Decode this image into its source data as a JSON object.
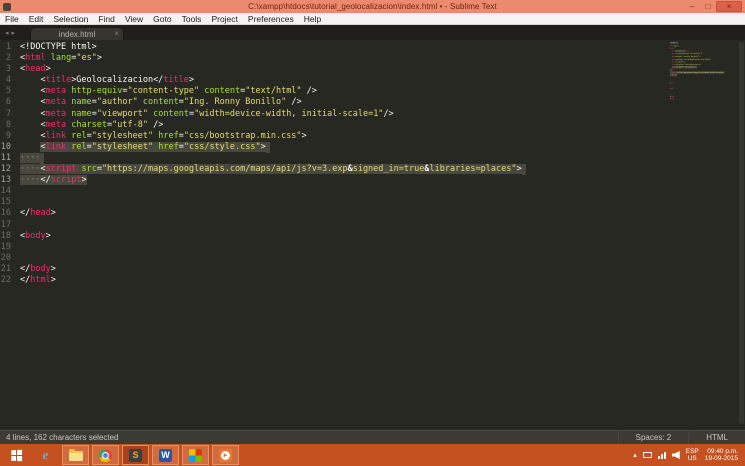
{
  "window": {
    "title": "C:\\xampp\\htdocs\\tutorial_geolocalizacion\\index.html • - Sublime Text",
    "controls": {
      "minimize": "–",
      "maximize": "□",
      "close": "×"
    }
  },
  "menu": {
    "items": [
      "File",
      "Edit",
      "Selection",
      "Find",
      "View",
      "Goto",
      "Tools",
      "Project",
      "Preferences",
      "Help"
    ]
  },
  "tabs": {
    "scroll_left_icon": "◂",
    "scroll_right_icon": "▸",
    "active": {
      "label": "index.html",
      "close_icon": "×"
    }
  },
  "editor": {
    "syntax_colors": {
      "w": "#F8F8F2",
      "tag": "#F92672",
      "attr": "#A6E22E",
      "str": "#E6DB74",
      "ws": "#8a8a7f",
      "b": "#F8F8F2"
    },
    "selection_bg": "#49483E",
    "background": "#272822",
    "lines": [
      {
        "n": 1,
        "segs": [
          [
            "w",
            "<!DOCTYPE html>"
          ]
        ]
      },
      {
        "n": 2,
        "segs": [
          [
            "w",
            "<"
          ],
          [
            "tag",
            "html"
          ],
          [
            "w",
            " "
          ],
          [
            "attr",
            "lang"
          ],
          [
            "w",
            "="
          ],
          [
            "str",
            "\"es\""
          ],
          [
            "w",
            ">"
          ]
        ]
      },
      {
        "n": 3,
        "segs": [
          [
            "w",
            "<"
          ],
          [
            "tag",
            "head"
          ],
          [
            "w",
            ">"
          ]
        ]
      },
      {
        "n": 4,
        "segs": [
          [
            "w",
            "    <"
          ],
          [
            "tag",
            "title"
          ],
          [
            "w",
            ">Geolocalizacion</"
          ],
          [
            "tag",
            "title"
          ],
          [
            "w",
            ">"
          ]
        ]
      },
      {
        "n": 5,
        "segs": [
          [
            "w",
            "    <"
          ],
          [
            "tag",
            "meta"
          ],
          [
            "w",
            " "
          ],
          [
            "attr",
            "http-equiv"
          ],
          [
            "w",
            "="
          ],
          [
            "str",
            "\"content-type\""
          ],
          [
            "w",
            " "
          ],
          [
            "attr",
            "content"
          ],
          [
            "w",
            "="
          ],
          [
            "str",
            "\"text/html\""
          ],
          [
            "w",
            " />"
          ]
        ]
      },
      {
        "n": 6,
        "segs": [
          [
            "w",
            "    <"
          ],
          [
            "tag",
            "meta"
          ],
          [
            "w",
            " "
          ],
          [
            "attr",
            "name"
          ],
          [
            "w",
            "="
          ],
          [
            "str",
            "\"author\""
          ],
          [
            "w",
            " "
          ],
          [
            "attr",
            "content"
          ],
          [
            "w",
            "="
          ],
          [
            "str",
            "\"Ing. Ronny Bonillo\""
          ],
          [
            "w",
            " />"
          ]
        ]
      },
      {
        "n": 7,
        "segs": [
          [
            "w",
            "    <"
          ],
          [
            "tag",
            "meta"
          ],
          [
            "w",
            " "
          ],
          [
            "attr",
            "name"
          ],
          [
            "w",
            "="
          ],
          [
            "str",
            "\"viewport\""
          ],
          [
            "w",
            " "
          ],
          [
            "attr",
            "content"
          ],
          [
            "w",
            "="
          ],
          [
            "str",
            "\"width=device-width, initial-scale=1\""
          ],
          [
            "w",
            "/>"
          ]
        ]
      },
      {
        "n": 8,
        "segs": [
          [
            "w",
            "    <"
          ],
          [
            "tag",
            "meta"
          ],
          [
            "w",
            " "
          ],
          [
            "attr",
            "charset"
          ],
          [
            "w",
            "="
          ],
          [
            "str",
            "\"utf-8\""
          ],
          [
            "w",
            " />"
          ]
        ]
      },
      {
        "n": 9,
        "segs": [
          [
            "w",
            "    <"
          ],
          [
            "tag",
            "link"
          ],
          [
            "w",
            " "
          ],
          [
            "attr",
            "rel"
          ],
          [
            "w",
            "="
          ],
          [
            "str",
            "\"stylesheet\""
          ],
          [
            "w",
            " "
          ],
          [
            "attr",
            "href"
          ],
          [
            "w",
            "="
          ],
          [
            "str",
            "\"css/bootstrap.min.css\""
          ],
          [
            "w",
            ">"
          ]
        ]
      },
      {
        "n": 10,
        "selEol": true,
        "segs": [
          [
            "w",
            "    "
          ],
          [
            "w",
            "<",
            1
          ],
          [
            "tag",
            "link",
            1
          ],
          [
            "w",
            " ",
            1
          ],
          [
            "attr",
            "rel",
            1
          ],
          [
            "w",
            "=",
            1
          ],
          [
            "str",
            "\"stylesheet\"",
            1
          ],
          [
            "w",
            " ",
            1
          ],
          [
            "attr",
            "href",
            1
          ],
          [
            "w",
            "=",
            1
          ],
          [
            "str",
            "\"css/style.css\"",
            1
          ],
          [
            "w",
            ">",
            1
          ]
        ]
      },
      {
        "n": 11,
        "selEol": true,
        "segs": [
          [
            "ws",
            "····",
            1
          ]
        ]
      },
      {
        "n": 12,
        "selEol": true,
        "segs": [
          [
            "ws",
            "····",
            1
          ],
          [
            "w",
            "<",
            1
          ],
          [
            "tag",
            "script",
            1
          ],
          [
            "w",
            " ",
            1
          ],
          [
            "attr",
            "src",
            1
          ],
          [
            "w",
            "=",
            1
          ],
          [
            "str",
            "\"https://maps.googleapis.com/maps/api/js?v=3.exp",
            1
          ],
          [
            "b",
            "&",
            1
          ],
          [
            "str",
            "signed_in=true",
            1
          ],
          [
            "b",
            "&",
            1
          ],
          [
            "str",
            "libraries=places\"",
            1
          ],
          [
            "w",
            ">",
            1
          ]
        ]
      },
      {
        "n": 13,
        "segs": [
          [
            "ws",
            "····",
            1
          ],
          [
            "w",
            "</",
            1
          ],
          [
            "tag",
            "script",
            1
          ],
          [
            "w",
            ">",
            1
          ]
        ]
      },
      {
        "n": 14,
        "segs": []
      },
      {
        "n": 15,
        "segs": []
      },
      {
        "n": 16,
        "segs": [
          [
            "w",
            "</"
          ],
          [
            "tag",
            "head"
          ],
          [
            "w",
            ">"
          ]
        ]
      },
      {
        "n": 17,
        "segs": []
      },
      {
        "n": 18,
        "segs": [
          [
            "w",
            "<"
          ],
          [
            "tag",
            "body"
          ],
          [
            "w",
            ">"
          ]
        ]
      },
      {
        "n": 19,
        "segs": []
      },
      {
        "n": 20,
        "segs": []
      },
      {
        "n": 21,
        "segs": [
          [
            "w",
            "</"
          ],
          [
            "tag",
            "body"
          ],
          [
            "w",
            ">"
          ]
        ]
      },
      {
        "n": 22,
        "segs": [
          [
            "w",
            "</"
          ],
          [
            "tag",
            "html"
          ],
          [
            "w",
            ">"
          ]
        ]
      }
    ]
  },
  "status": {
    "left": "4 lines, 162 characters selected",
    "spaces": "Spaces: 2",
    "syntax": "HTML"
  },
  "taskbar": {
    "apps": [
      {
        "name": "internet-explorer",
        "label": "e",
        "open": false,
        "active": false
      },
      {
        "name": "file-explorer",
        "label": "",
        "open": true,
        "active": false
      },
      {
        "name": "chrome",
        "label": "",
        "open": true,
        "active": false
      },
      {
        "name": "sublime-text",
        "label": "S",
        "open": true,
        "active": true
      },
      {
        "name": "word",
        "label": "W",
        "open": true,
        "active": false
      },
      {
        "name": "office",
        "label": "",
        "open": true,
        "active": false
      },
      {
        "name": "media-player",
        "label": "",
        "open": true,
        "active": false
      }
    ],
    "tray": {
      "expand_icon": "▴",
      "lang_top": "ESP",
      "lang_bottom": "US",
      "time": "09:40 p.m.",
      "date": "19-09-2015"
    }
  }
}
